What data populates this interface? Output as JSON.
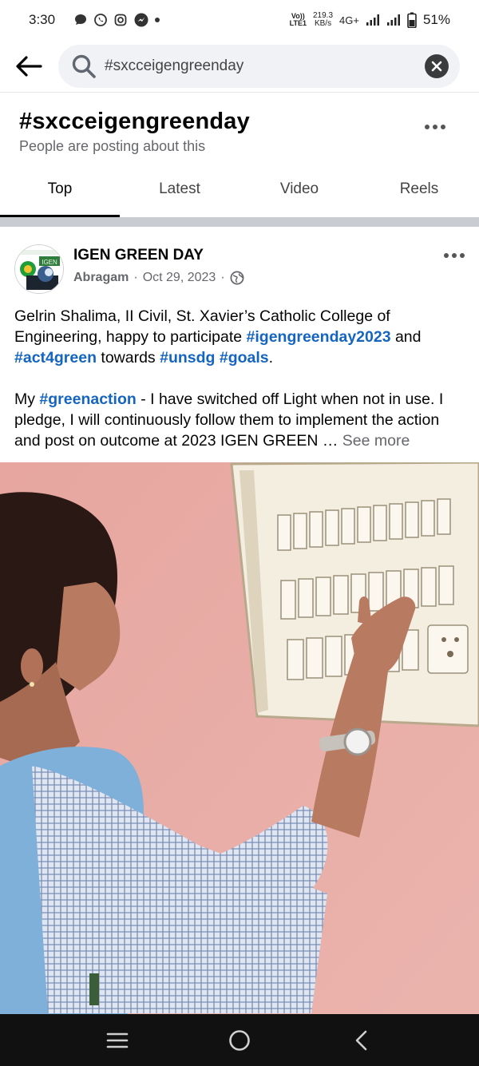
{
  "status_bar": {
    "time": "3:30",
    "volte_top": "Vo))",
    "volte_bottom": "LTE1",
    "speed_value": "219.3",
    "speed_unit": "KB/s",
    "network": "4G+",
    "battery": "51%"
  },
  "search": {
    "query": "#sxcceigengreenday"
  },
  "hashtag": {
    "title": "#sxcceigengreenday",
    "subtitle": "People are posting about this"
  },
  "tabs": [
    {
      "label": "Top",
      "active": true
    },
    {
      "label": "Latest",
      "active": false
    },
    {
      "label": "Video",
      "active": false
    },
    {
      "label": "Reels",
      "active": false
    }
  ],
  "post": {
    "page_name": "IGEN GREEN DAY",
    "author": "Abragam",
    "separator": "·",
    "date": "Oct 29, 2023",
    "text": {
      "p1_a": "Gelrin Shalima, II Civil, St. Xavier’s Catholic College of Engineering, happy to participate ",
      "tag1": "#igengreenday2023",
      "p1_b": " and ",
      "tag2": "#act4green",
      "p1_c": " towards ",
      "tag3": "#unsdg",
      "p1_d": " ",
      "tag4": "#goals",
      "p1_e": ".",
      "p2_a": "My ",
      "tag5": "#greenaction",
      "p2_b": " - I have switched off Light when not in use. I pledge, I will continuously follow them to implement the action and post on outcome at 2023 IGEN GREEN … ",
      "see_more": "See more"
    },
    "avatar_text": "IGEN"
  },
  "colors": {
    "hashtag": "#1565c0",
    "muted": "#65676b",
    "wall": "#e8aea8"
  }
}
